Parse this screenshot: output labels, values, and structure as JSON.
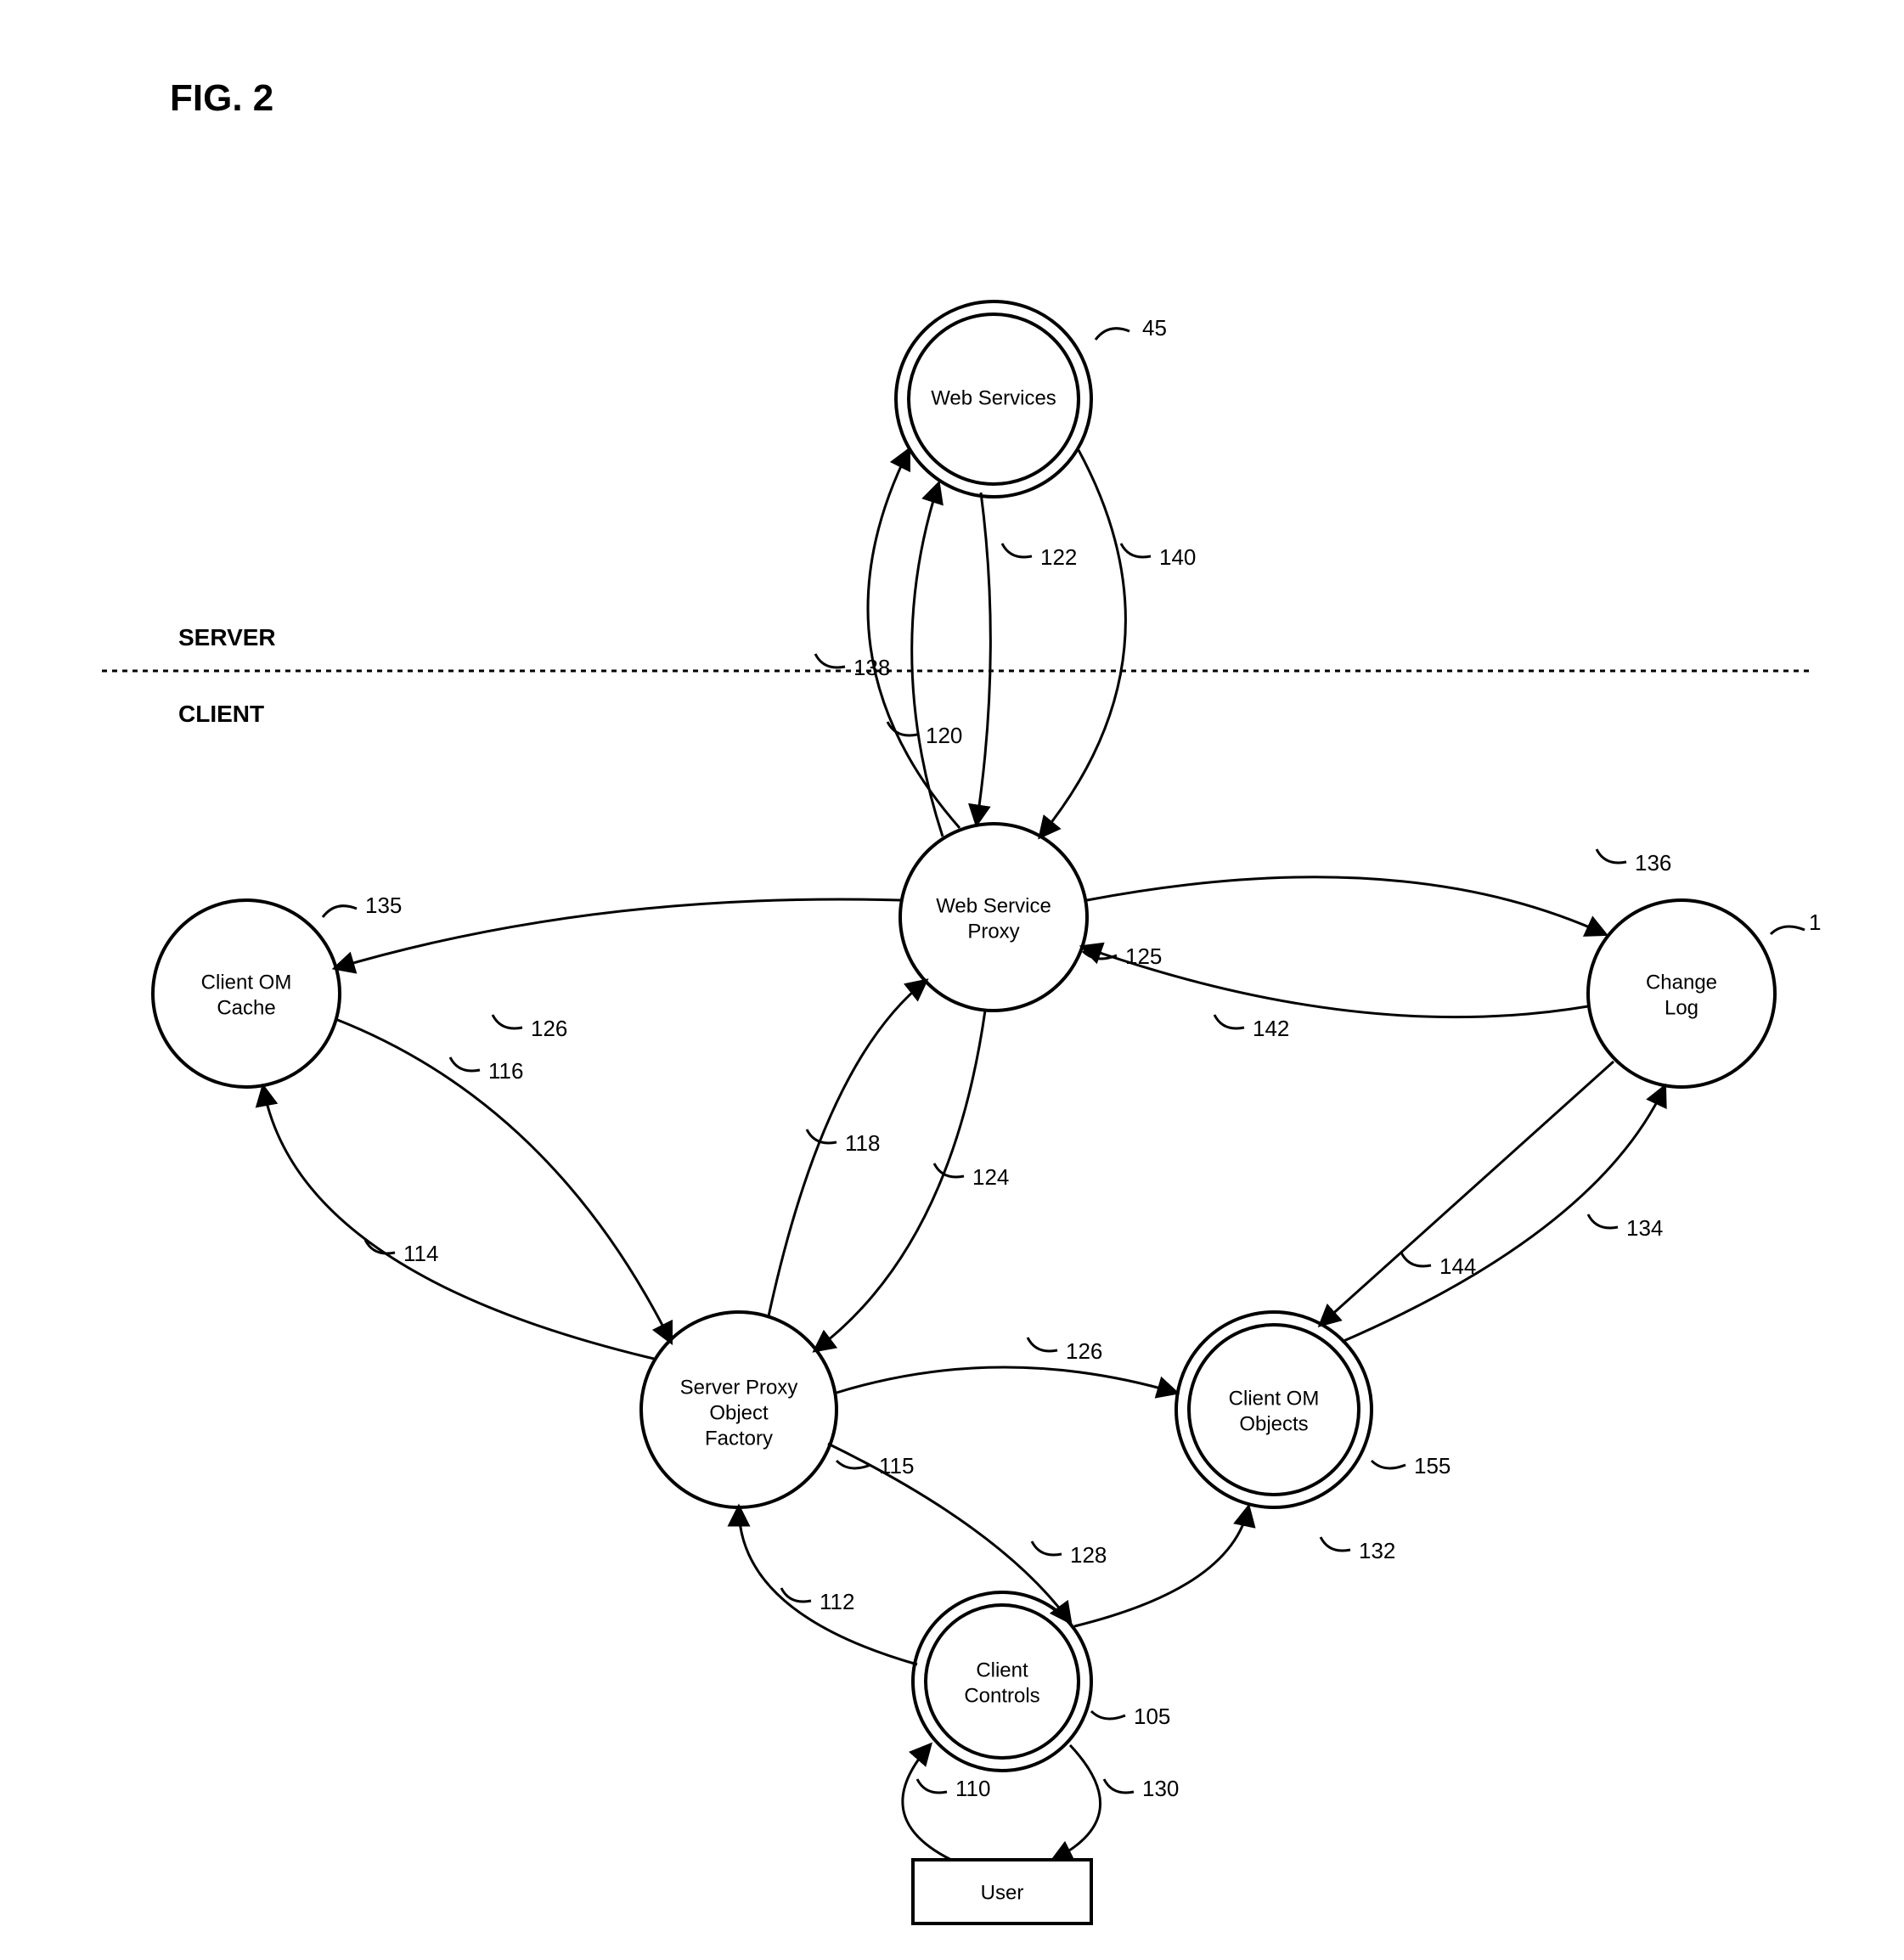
{
  "figure_label": "FIG. 2",
  "zones": {
    "server": "SERVER",
    "client": "CLIENT"
  },
  "nodes": {
    "web_services": {
      "label": "Web Services",
      "ref": "45"
    },
    "web_proxy": {
      "label1": "Web Service",
      "label2": "Proxy",
      "ref": "125"
    },
    "client_cache": {
      "label1": "Client OM",
      "label2": "Cache",
      "ref": "135"
    },
    "change_log": {
      "label1": "Change",
      "label2": "Log",
      "ref": "1"
    },
    "factory": {
      "label1": "Server Proxy",
      "label2": "Object",
      "label3": "Factory",
      "ref": "115"
    },
    "client_objects": {
      "label1": "Client OM",
      "label2": "Objects",
      "ref": "155"
    },
    "client_controls": {
      "label1": "Client",
      "label2": "Controls",
      "ref": "105"
    },
    "user": {
      "label": "User"
    }
  },
  "edges": {
    "e110": "110",
    "e112": "112",
    "e114": "114",
    "e116": "116",
    "e118": "118",
    "e120": "120",
    "e122": "122",
    "e124": "124",
    "e126a": "126",
    "e126b": "126",
    "e128": "128",
    "e130": "130",
    "e132": "132",
    "e134": "134",
    "e136": "136",
    "e138": "138",
    "e140": "140",
    "e142": "142",
    "e144": "144"
  }
}
